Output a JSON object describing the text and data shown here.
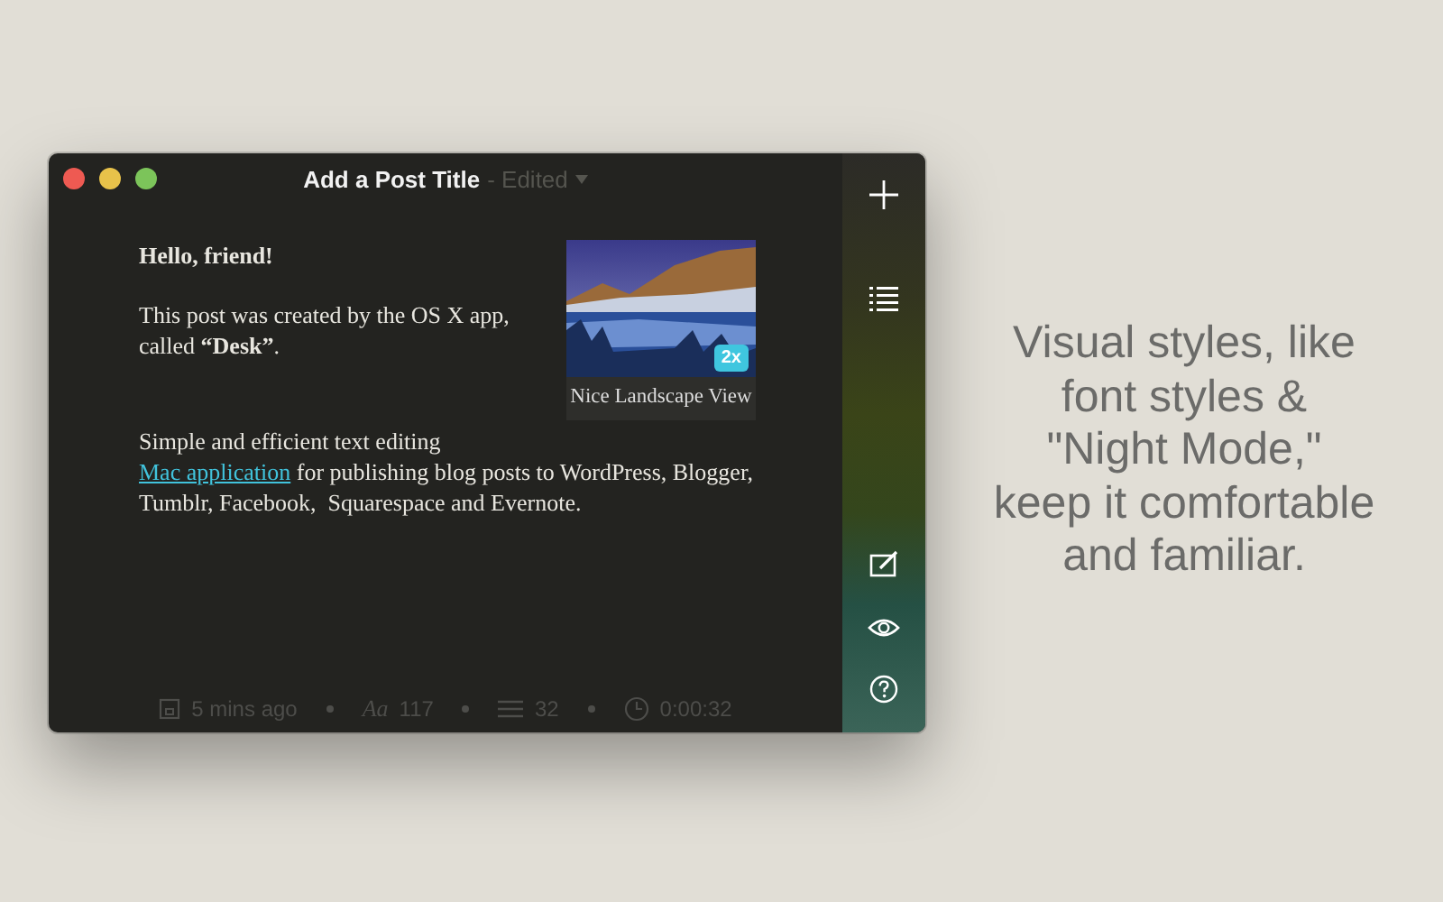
{
  "window": {
    "title": "Add a Post Title",
    "status": "- Edited"
  },
  "post": {
    "paragraphs": [
      {
        "kind": "heading",
        "text": "Hello, friend!"
      },
      {
        "kind": "text",
        "text": "This post was created by the OS X app, called **“Desk”**."
      },
      {
        "kind": "link_text",
        "before": "Simple and efficient text editing",
        "link": "Mac application",
        "after": "for publishing blog posts to WordPress, Blogger, Tumblr, Facebook,  Squarespace and Evernote."
      }
    ],
    "image": {
      "badge": "2x",
      "caption": "Nice Landscape View"
    }
  },
  "status_bar": [
    {
      "kind": "saved",
      "text": "5 mins ago"
    },
    {
      "kind": "characters",
      "icon_text": "Aa",
      "text": "117"
    },
    {
      "kind": "lines",
      "text": "32"
    },
    {
      "kind": "time",
      "text": "0:00:32"
    }
  ],
  "toolbar": [
    {
      "kind": "add"
    },
    {
      "kind": "list"
    },
    {
      "kind": "spacer"
    },
    {
      "kind": "edit"
    },
    {
      "kind": "preview"
    },
    {
      "kind": "help"
    }
  ],
  "caption": "Visual styles, like\nfont styles &\n\"Night Mode,\"\nkeep it comfortable\nand familiar."
}
